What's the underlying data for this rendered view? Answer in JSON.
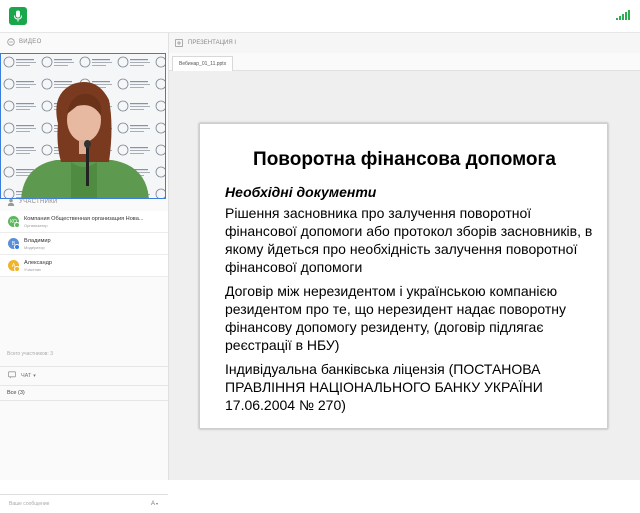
{
  "app": {
    "logo_icon": "microphone-icon",
    "signal_icon": "signal-bars-icon",
    "accent": "#1aa64a"
  },
  "video_panel": {
    "label": "ВИДЕО"
  },
  "participants": {
    "label": "УЧАСТНИКИ",
    "items": [
      {
        "initials": "КО",
        "name": "Компания Общественная организация Нова...",
        "role": "Организатор",
        "color": "#5cb85c",
        "status_color": "#5cb85c"
      },
      {
        "initials": "В",
        "name": "Владимир",
        "role": "Модератор",
        "color": "#5b8fd6",
        "status_color": "#3a7be0"
      },
      {
        "initials": "А",
        "name": "Александр",
        "role": "Участник",
        "color": "#f0b429",
        "status_color": "#f0b429"
      }
    ],
    "total": "Всего участников: 3"
  },
  "chat": {
    "label": "ЧАТ",
    "filter": "Все (3)",
    "input_placeholder": "Ваше сообщение",
    "font_button": "A"
  },
  "presentation": {
    "label": "ПРЕЗЕНТАЦИЯ I",
    "file_tab": "Вебинар_01_11.pptx"
  },
  "slide": {
    "title": "Поворотна фінансова допомога",
    "subtitle": "Необхідні документи",
    "paragraphs": [
      "Рішення засновника про залучення поворотної фінансової допомоги або протокол зборів засновників, в якому йдеться про необхідність залучення поворотної фінансової допомоги",
      "Договір між нерезидентом і українською компанією резидентом про те, що нерезидент надає поворотну фінансову допомогу резиденту, (договір підлягає реєстрації в НБУ)",
      "Індивідуальна банківська ліцензія (ПОСТАНОВА ПРАВЛІННЯ НАЦІОНАЛЬНОГО БАНКУ УКРАЇНИ 17.06.2004  № 270)"
    ]
  }
}
